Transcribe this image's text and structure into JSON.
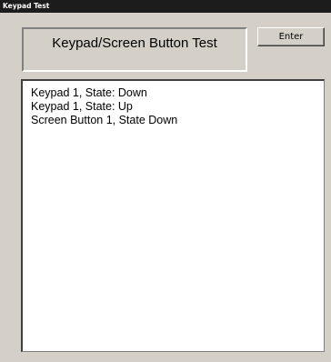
{
  "window": {
    "title": "Keypad Test"
  },
  "header": {
    "title": "Keypad/Screen Button Test"
  },
  "toolbar": {
    "enter_label": "Enter"
  },
  "log": {
    "lines": [
      "Keypad 1, State: Down",
      "Keypad 1, State: Up",
      "Screen Button 1, State Down"
    ]
  }
}
